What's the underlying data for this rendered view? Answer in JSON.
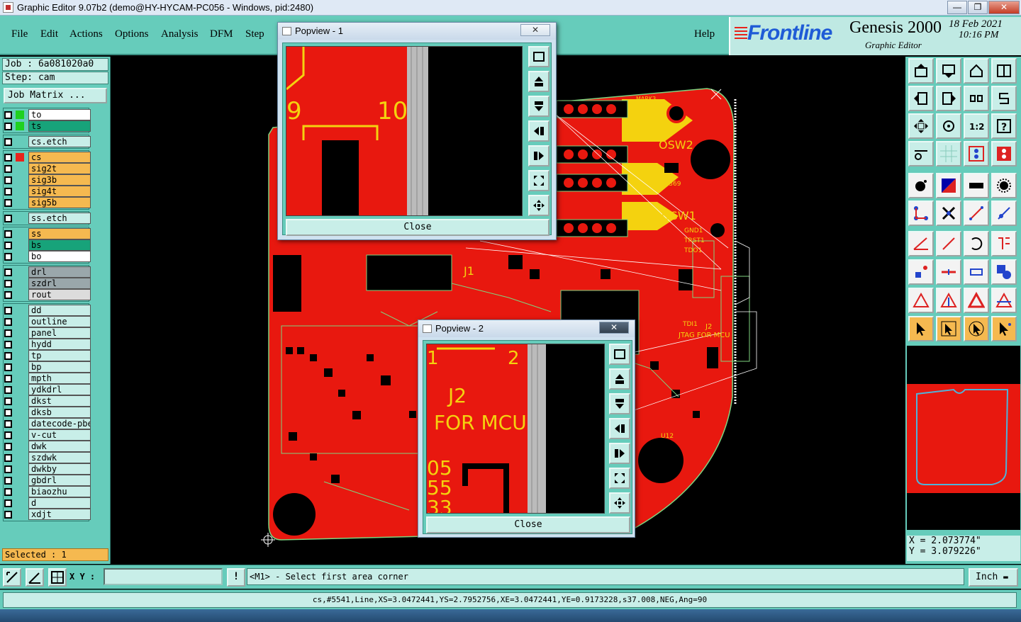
{
  "window": {
    "title": "Graphic Editor 9.07b2 (demo@HY-HYCAM-PC056 - Windows, pid:2480)",
    "minimize": "—",
    "maximize": "❐",
    "close": "✕"
  },
  "menu": {
    "items": [
      "File",
      "Edit",
      "Actions",
      "Options",
      "Analysis",
      "DFM",
      "Step"
    ],
    "help": "Help"
  },
  "brand": {
    "logo": "Frontline",
    "product": "Genesis 2000",
    "subtitle": "Graphic Editor",
    "date": "18 Feb 2021",
    "time": "10:16 PM"
  },
  "left": {
    "job": "Job : 6a081020a0",
    "step": "Step: cam",
    "job_matrix": "Job Matrix ...",
    "selected": "Selected : 1"
  },
  "layers": [
    {
      "name": "to",
      "color": "#ffffff",
      "mark": "#1fd11f"
    },
    {
      "name": "ts",
      "color": "#17a37a",
      "mark": "#1fd11f"
    },
    {
      "name": "cs.etch",
      "color": "#c8eee8",
      "mark": ""
    },
    {
      "name": "cs",
      "color": "#f5b950",
      "mark": "#e8231b"
    },
    {
      "name": "sig2t",
      "color": "#f5b950",
      "mark": ""
    },
    {
      "name": "sig3b",
      "color": "#f5b950",
      "mark": ""
    },
    {
      "name": "sig4t",
      "color": "#f5b950",
      "mark": ""
    },
    {
      "name": "sig5b",
      "color": "#f5b950",
      "mark": ""
    },
    {
      "name": "ss.etch",
      "color": "#c8eee8",
      "mark": ""
    },
    {
      "name": "ss",
      "color": "#f5b950",
      "mark": ""
    },
    {
      "name": "bs",
      "color": "#17a37a",
      "mark": ""
    },
    {
      "name": "bo",
      "color": "#ffffff",
      "mark": ""
    },
    {
      "name": "drl",
      "color": "#9aa7ab",
      "mark": ""
    },
    {
      "name": "szdrl",
      "color": "#9aa7ab",
      "mark": ""
    },
    {
      "name": "rout",
      "color": "#dcdcdc",
      "mark": ""
    },
    {
      "name": "dd",
      "color": "#c8eee8",
      "mark": ""
    },
    {
      "name": "outline",
      "color": "#c8eee8",
      "mark": ""
    },
    {
      "name": "panel",
      "color": "#c8eee8",
      "mark": ""
    },
    {
      "name": "hydd",
      "color": "#c8eee8",
      "mark": ""
    },
    {
      "name": "tp",
      "color": "#c8eee8",
      "mark": ""
    },
    {
      "name": "bp",
      "color": "#c8eee8",
      "mark": ""
    },
    {
      "name": "mpth",
      "color": "#c8eee8",
      "mark": ""
    },
    {
      "name": "ydkdrl",
      "color": "#c8eee8",
      "mark": ""
    },
    {
      "name": "dkst",
      "color": "#c8eee8",
      "mark": ""
    },
    {
      "name": "dksb",
      "color": "#c8eee8",
      "mark": ""
    },
    {
      "name": "datecode-pbe",
      "color": "#c8eee8",
      "mark": ""
    },
    {
      "name": "v-cut",
      "color": "#c8eee8",
      "mark": ""
    },
    {
      "name": "dwk",
      "color": "#c8eee8",
      "mark": ""
    },
    {
      "name": "szdwk",
      "color": "#c8eee8",
      "mark": ""
    },
    {
      "name": "dwkby",
      "color": "#c8eee8",
      "mark": ""
    },
    {
      "name": "gbdrl",
      "color": "#c8eee8",
      "mark": ""
    },
    {
      "name": "biaozhu",
      "color": "#c8eee8",
      "mark": ""
    },
    {
      "name": "d",
      "color": "#c8eee8",
      "mark": ""
    },
    {
      "name": "xdjt",
      "color": "#c8eee8",
      "mark": ""
    }
  ],
  "board_labels": {
    "osw2": "OSW2",
    "osw1": "OSW1",
    "j1": "J1",
    "j2": "J2",
    "jtag": "JTAG FOR MCU",
    "r369": "R369",
    "u12": "U12",
    "mark": "MARK3",
    "trst": "TRST1",
    "tdo": "TDO1",
    "gnd": "GND1",
    "tdi": "TDI1"
  },
  "popview1": {
    "title": "Popview - 1",
    "close_btn": "Close",
    "label_a": "9",
    "label_b": "10"
  },
  "popview2": {
    "title": "Popview - 2",
    "close_btn": "Close",
    "label_a": "1",
    "label_b": "2",
    "label_c": "J2",
    "label_d": "FOR MCU",
    "label_e": "05",
    "label_f": "55",
    "label_g": "33"
  },
  "coords": {
    "x": "X = 2.073774\"",
    "y": "Y = 3.079226\""
  },
  "bottom": {
    "xy_label": "X Y :",
    "xy_value": "",
    "warn": "!",
    "prompt": "<M1> - Select first area corner",
    "unit": "Inch"
  },
  "status": "cs,#5541,Line,XS=3.0472441,YS=2.7952756,XE=3.0472441,YE=0.9173228,s37.008,NEG,Ang=90"
}
